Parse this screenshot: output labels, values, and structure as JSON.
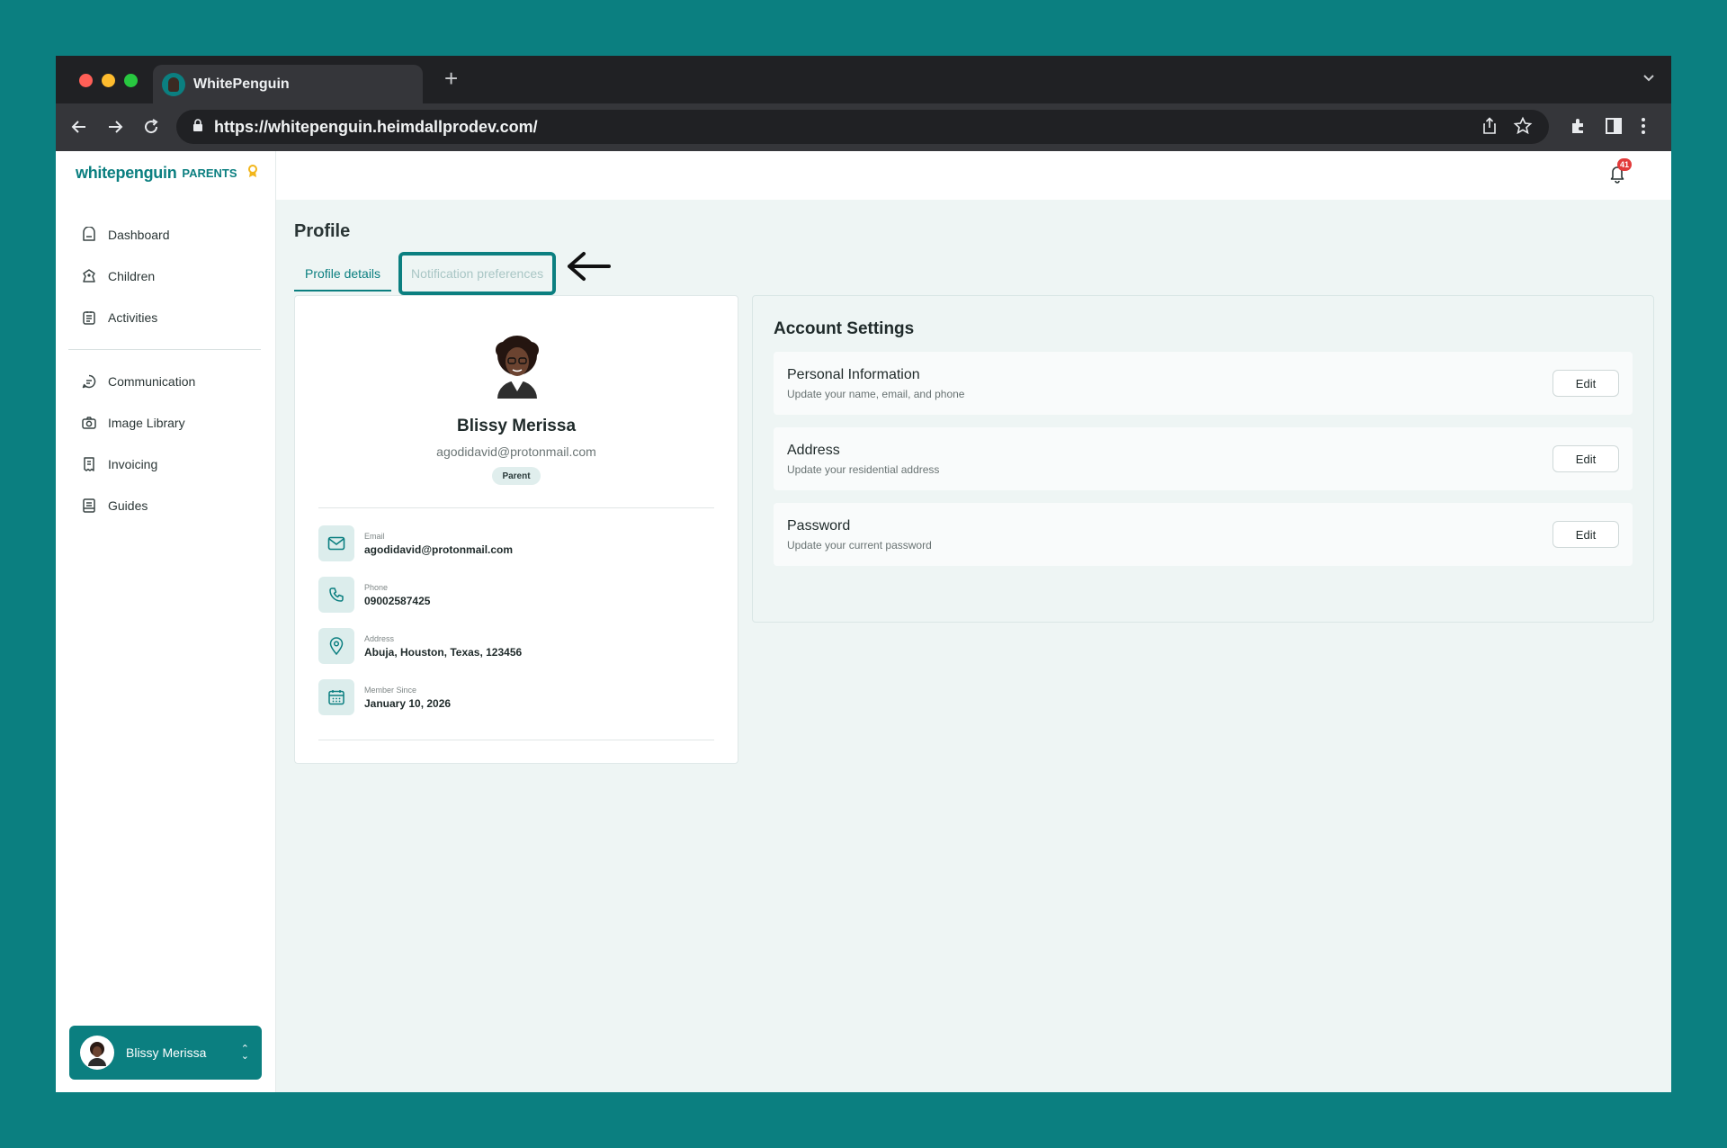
{
  "browser": {
    "tab_title": "WhitePenguin",
    "url": "https://whitepenguin.heimdallprodev.com/"
  },
  "brand": {
    "logo_word": "whitepenguin",
    "logo_sub": "PARENTS",
    "accent_color": "#0b7f80"
  },
  "sidebar": {
    "items_primary": [
      {
        "label": "Dashboard",
        "icon": "dashboard-icon"
      },
      {
        "label": "Children",
        "icon": "children-icon"
      },
      {
        "label": "Activities",
        "icon": "activities-icon"
      }
    ],
    "items_secondary": [
      {
        "label": "Communication",
        "icon": "chat-icon"
      },
      {
        "label": "Image Library",
        "icon": "camera-icon"
      },
      {
        "label": "Invoicing",
        "icon": "invoice-icon"
      },
      {
        "label": "Guides",
        "icon": "guide-icon"
      }
    ],
    "user_name": "Blissy Merissa"
  },
  "topbar": {
    "notification_count": "41"
  },
  "page": {
    "title": "Profile",
    "tabs": [
      {
        "label": "Profile details",
        "active": true
      },
      {
        "label": "Notification preferences",
        "active": false
      }
    ]
  },
  "profile": {
    "name": "Blissy Merissa",
    "email": "agodidavid@protonmail.com",
    "role": "Parent",
    "details": [
      {
        "label": "Email",
        "value": "agodidavid@protonmail.com",
        "icon": "mail-icon"
      },
      {
        "label": "Phone",
        "value": "09002587425",
        "icon": "phone-icon"
      },
      {
        "label": "Address",
        "value": "Abuja, Houston, Texas, 123456",
        "icon": "location-icon"
      },
      {
        "label": "Member Since",
        "value": "January 10, 2026",
        "icon": "calendar-icon"
      }
    ]
  },
  "account_settings": {
    "title": "Account Settings",
    "rows": [
      {
        "title": "Personal Information",
        "desc": "Update your name, email, and phone",
        "button": "Edit"
      },
      {
        "title": "Address",
        "desc": "Update your residential address",
        "button": "Edit"
      },
      {
        "title": "Password",
        "desc": "Update your current password",
        "button": "Edit"
      }
    ]
  }
}
